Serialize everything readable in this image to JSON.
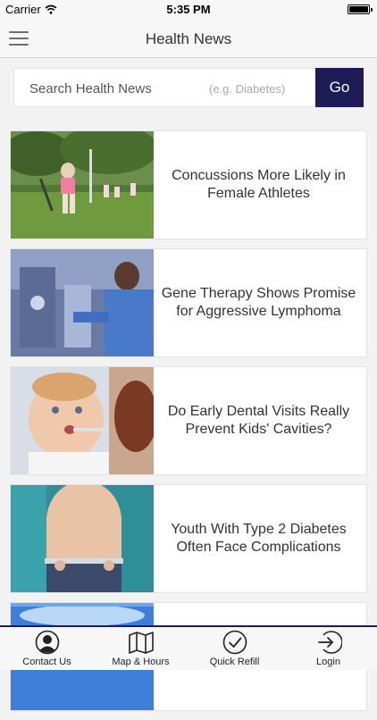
{
  "status_bar": {
    "carrier": "Carrier",
    "time": "5:35 PM"
  },
  "nav": {
    "title": "Health News",
    "menu_icon": "hamburger-menu-icon"
  },
  "search": {
    "label": "Search Health News",
    "hint": "(e.g. Diabetes)",
    "go_label": "Go"
  },
  "news": [
    {
      "headline": "Concussions More Likely in Female Athletes",
      "image": "female-athletes-field-hockey-photo"
    },
    {
      "headline": "Gene Therapy Shows Promise for Aggressive Lymphoma",
      "image": "lab-researcher-photo"
    },
    {
      "headline": "Do Early Dental Visits Really Prevent Kids' Cavities?",
      "image": "baby-toothbrush-photo"
    },
    {
      "headline": "Youth With Type 2 Diabetes Often Face Complications",
      "image": "child-waist-measurement-photo"
    },
    {
      "headline": "",
      "image": "blue-light-photo"
    }
  ],
  "tabs": [
    {
      "label": "Contact Us",
      "icon": "person-icon"
    },
    {
      "label": "Map & Hours",
      "icon": "map-icon"
    },
    {
      "label": "Quick Refill",
      "icon": "checkmark-icon"
    },
    {
      "label": "Login",
      "icon": "login-arrow-icon"
    }
  ],
  "colors": {
    "accent": "#1d1c57",
    "background": "#f2f2f2",
    "text": "#333333"
  }
}
